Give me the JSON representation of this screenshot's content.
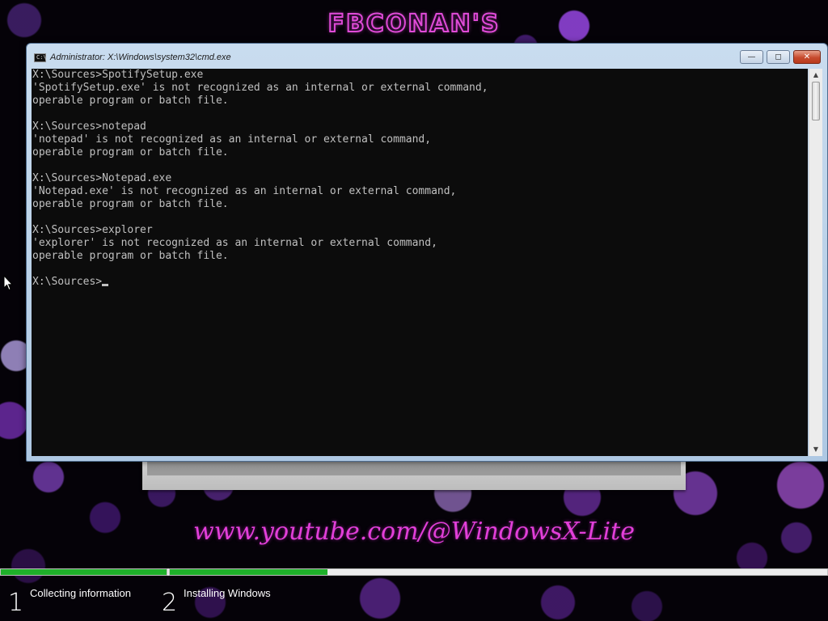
{
  "wallpaper": {
    "brand_text": "FBCONAN'S",
    "url_text": "www.youtube.com/@WindowsX-Lite"
  },
  "cmd_window": {
    "title": "Administrator: X:\\Windows\\system32\\cmd.exe",
    "icon_text": "C:\\",
    "buttons": {
      "minimize": "—",
      "maximize": "◻",
      "close": "✕"
    },
    "console_lines": [
      "X:\\Sources>SpotifySetup.exe",
      "'SpotifySetup.exe' is not recognized as an internal or external command,",
      "operable program or batch file.",
      "",
      "X:\\Sources>notepad",
      "'notepad' is not recognized as an internal or external command,",
      "operable program or batch file.",
      "",
      "X:\\Sources>Notepad.exe",
      "'Notepad.exe' is not recognized as an internal or external command,",
      "operable program or batch file.",
      "",
      "X:\\Sources>explorer",
      "'explorer' is not recognized as an internal or external command,",
      "operable program or batch file.",
      ""
    ],
    "prompt": "X:\\Sources>"
  },
  "setup_progress": {
    "accent_color": "#1fb02a",
    "steps": [
      {
        "number": "1",
        "label": "Collecting information",
        "progress": 1.0
      },
      {
        "number": "2",
        "label": "Installing Windows",
        "progress": 0.24
      }
    ]
  }
}
